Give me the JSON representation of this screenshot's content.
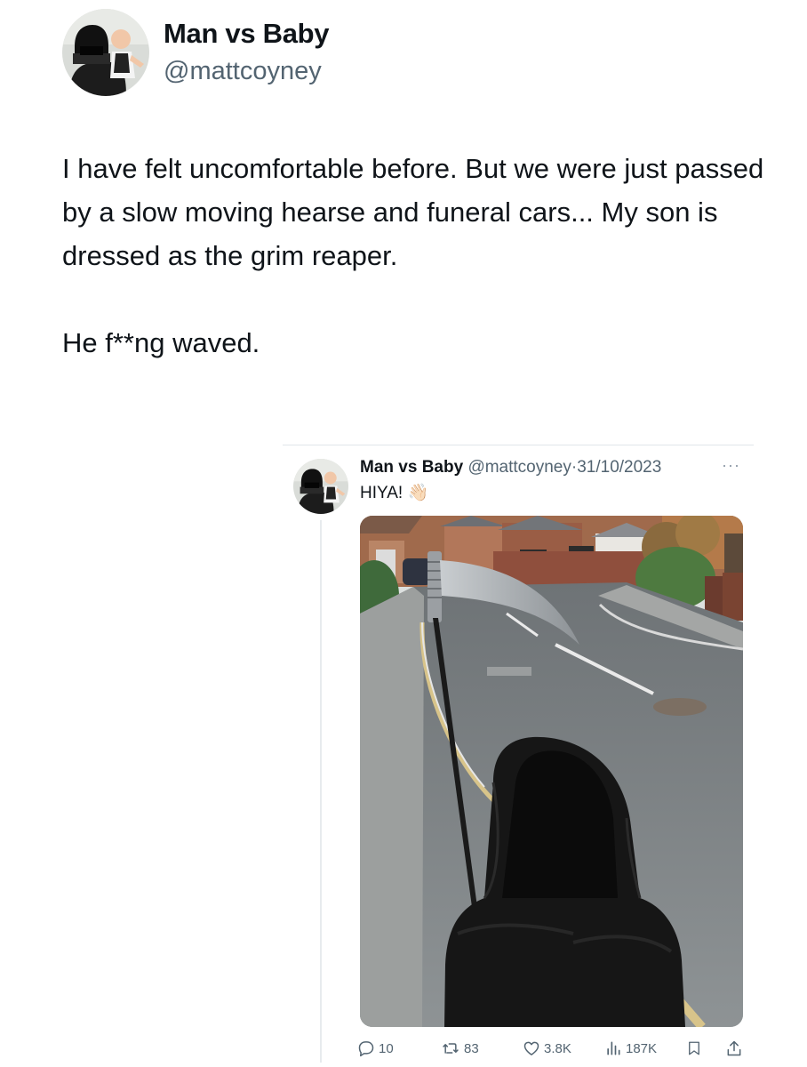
{
  "tweet": {
    "author_name": "Man vs Baby",
    "author_handle": "@mattcoyney",
    "text_paragraph_1": "I have felt uncomfortable before. But we were just passed by a slow moving hearse and funeral cars... My son is dressed as the grim reaper.",
    "text_paragraph_2": "He f**ng waved."
  },
  "quoted_tweet": {
    "author_name": "Man vs Baby",
    "author_handle": "@mattcoyney",
    "separator": "·",
    "date": "31/10/2023",
    "text": "HIYA! 👋🏻",
    "more_icon": "more-horizontal-icon",
    "image_icon": "grim-reaper-child-photo"
  },
  "actions": {
    "replies": "10",
    "reposts": "83",
    "likes": "3.8K",
    "views": "187K",
    "icons": [
      "reply-icon",
      "repost-icon",
      "like-icon",
      "views-icon",
      "bookmark-icon",
      "share-icon"
    ]
  },
  "colors": {
    "text_primary": "#0f1419",
    "text_secondary": "#536471",
    "divider": "#e1e6ea"
  }
}
